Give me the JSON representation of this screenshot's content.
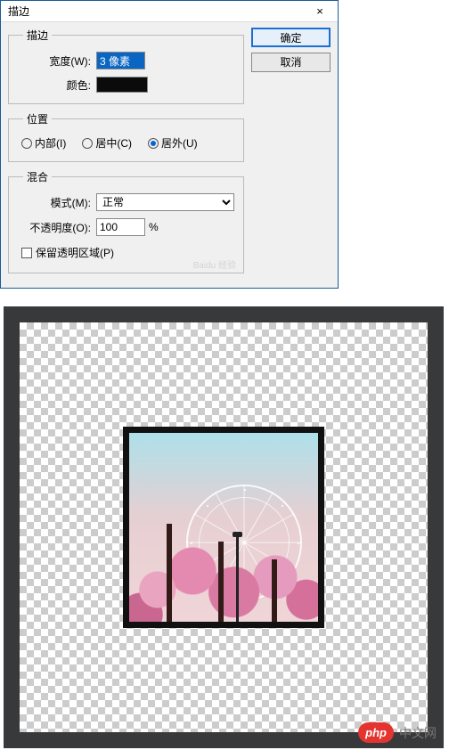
{
  "dialog": {
    "title": "描边",
    "close": "×",
    "stroke": {
      "legend": "描边",
      "width_label": "宽度(W):",
      "width_value": "3 像素",
      "color_label": "颜色:",
      "color_hex": "#0b0b0b"
    },
    "position": {
      "legend": "位置",
      "inside": "内部(I)",
      "center": "居中(C)",
      "outside": "居外(U)",
      "selected": "outside"
    },
    "blend": {
      "legend": "混合",
      "mode_label": "模式(M):",
      "mode_value": "正常",
      "opacity_label": "不透明度(O):",
      "opacity_value": "100",
      "opacity_unit": "%",
      "preserve_label": "保留透明区域(P)",
      "preserve_checked": false
    },
    "buttons": {
      "ok": "确定",
      "cancel": "取消"
    },
    "watermark": "Baidu 经验"
  },
  "footer": {
    "badge": "php",
    "text": "中文网"
  }
}
